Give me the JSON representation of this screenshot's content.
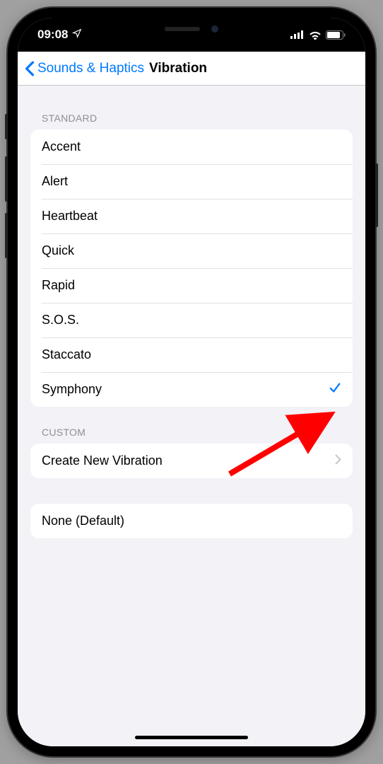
{
  "status": {
    "time": "09:08",
    "location_icon": "location-arrow"
  },
  "nav": {
    "back_label": "Sounds & Haptics",
    "title": "Vibration"
  },
  "sections": {
    "standard": {
      "header": "Standard",
      "items": [
        {
          "label": "Accent",
          "selected": false
        },
        {
          "label": "Alert",
          "selected": false
        },
        {
          "label": "Heartbeat",
          "selected": false
        },
        {
          "label": "Quick",
          "selected": false
        },
        {
          "label": "Rapid",
          "selected": false
        },
        {
          "label": "S.O.S.",
          "selected": false
        },
        {
          "label": "Staccato",
          "selected": false
        },
        {
          "label": "Symphony",
          "selected": true
        }
      ]
    },
    "custom": {
      "header": "Custom",
      "create_label": "Create New Vibration"
    },
    "none": {
      "label": "None (Default)"
    }
  }
}
